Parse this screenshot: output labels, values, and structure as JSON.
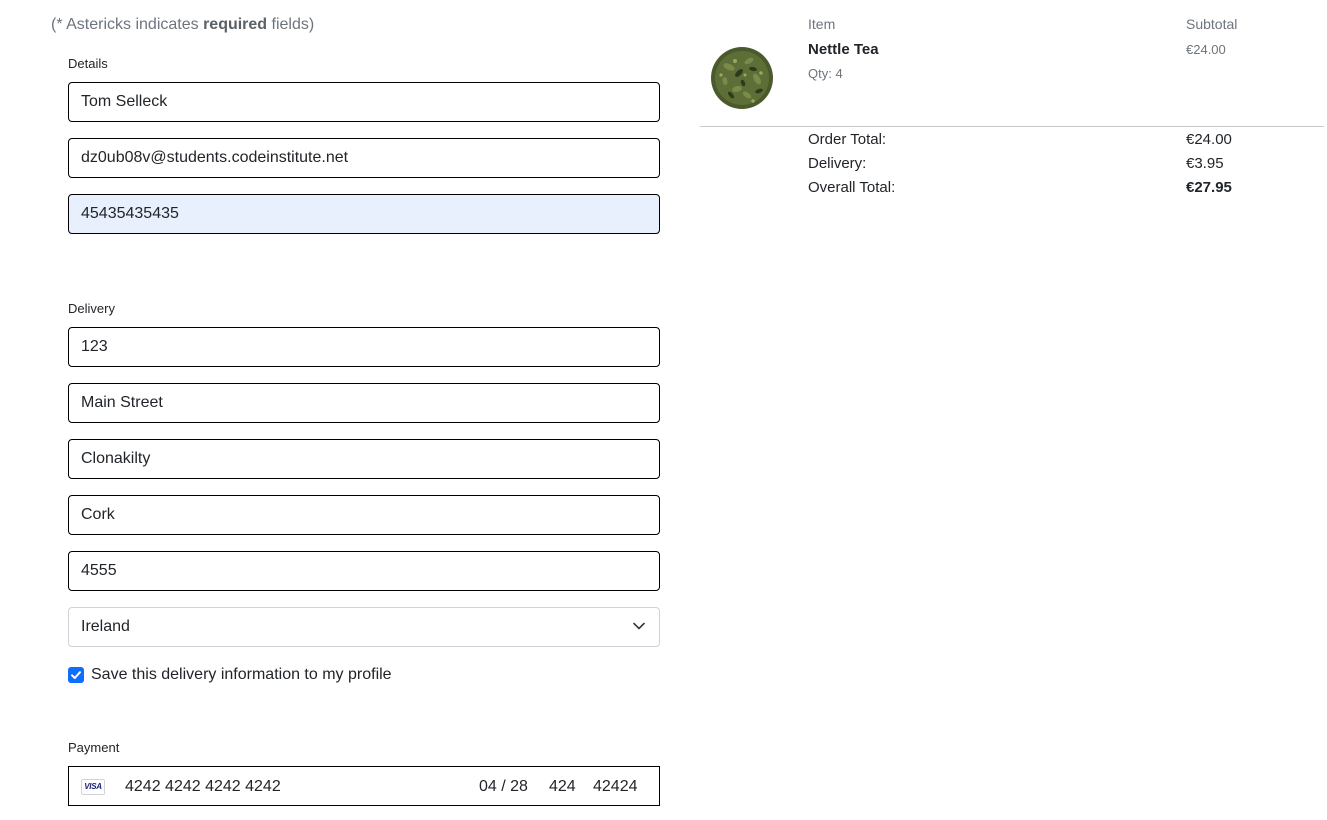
{
  "required_note": {
    "prefix": "(* Astericks indicates ",
    "bold": "required",
    "suffix": " fields)"
  },
  "details": {
    "label": "Details",
    "full_name": "Tom Selleck",
    "email": "dz0ub08v@students.codeinstitute.net",
    "phone": "45435435435"
  },
  "delivery": {
    "label": "Delivery",
    "street_address1": "123",
    "street_address2": "Main Street",
    "town_or_city": "Clonakilty",
    "county": "Cork",
    "postcode": "4555",
    "country": "Ireland",
    "save_info_label": "Save this delivery information to my profile",
    "save_info_checked": true
  },
  "payment": {
    "label": "Payment",
    "card_brand": "VISA",
    "card_number": "4242 4242 4242 4242",
    "expiry": "04 / 28",
    "cvc": "424",
    "postal": "42424"
  },
  "summary": {
    "col_item": "Item",
    "col_subtotal": "Subtotal",
    "items": [
      {
        "name": "Nettle Tea",
        "qty": "Qty: 4",
        "subtotal": "€24.00",
        "image_icon": "nettle-tea-leaves"
      }
    ],
    "order_total_label": "Order Total:",
    "order_total": "€24.00",
    "delivery_label": "Delivery:",
    "delivery_cost": "€3.95",
    "grand_total_label": "Overall Total:",
    "grand_total": "€27.95"
  },
  "colors": {
    "accent": "#0d6efd",
    "muted_text": "#6c757d",
    "autofill_bg": "#e8f0fe"
  }
}
